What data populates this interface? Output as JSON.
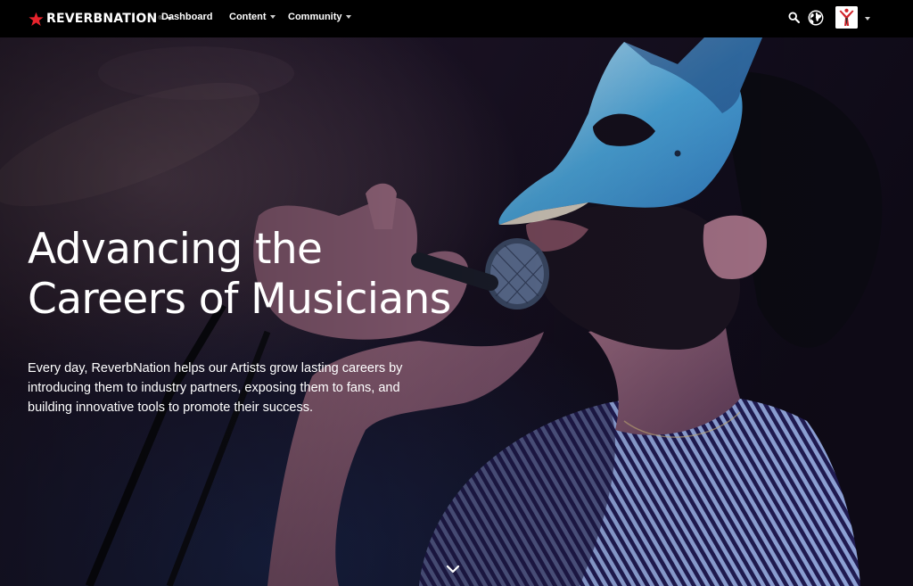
{
  "nav": {
    "logo_text": "REVERBNATION",
    "logo_reg": "®",
    "links": [
      {
        "label": "Dashboard",
        "has_dropdown": false
      },
      {
        "label": "Content",
        "has_dropdown": true
      },
      {
        "label": "Community",
        "has_dropdown": true
      }
    ],
    "icons": [
      "search-icon",
      "globe-icon",
      "avatar",
      "chevron-down-icon"
    ]
  },
  "hero": {
    "title_line1": "Advancing the",
    "title_line2": "Careers of Musicians",
    "description": "Every day, ReverbNation helps our Artists grow lasting careers by introducing them to industry partners, exposing them to fans, and building innovative tools to promote their success.",
    "scroll_icon": "chevron-down-icon"
  },
  "colors": {
    "nav_bg": "#000000",
    "brand_red": "#e8232c",
    "hero_overlay": "#1a0f2a"
  }
}
